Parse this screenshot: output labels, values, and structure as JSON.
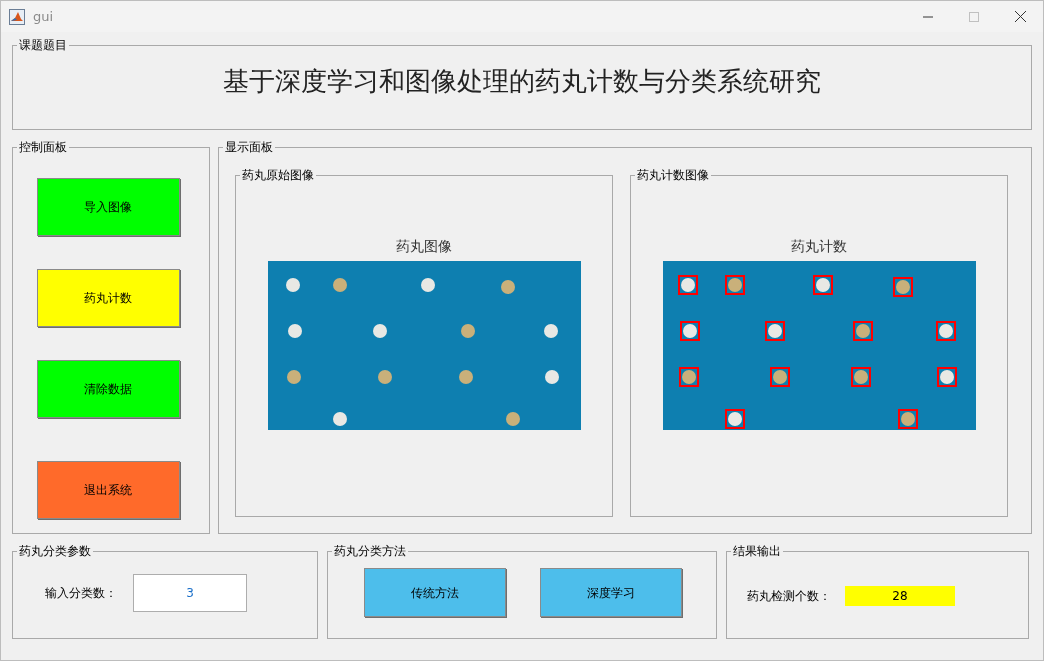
{
  "window": {
    "title": "gui"
  },
  "title_panel": {
    "legend": "课题题目",
    "text": "基于深度学习和图像处理的药丸计数与分类系统研究"
  },
  "control_panel": {
    "legend": "控制面板",
    "buttons": [
      {
        "label": "导入图像",
        "color": "#00ff00"
      },
      {
        "label": "药丸计数",
        "color": "#ffff00"
      },
      {
        "label": "清除数据",
        "color": "#00ff00"
      },
      {
        "label": "退出系统",
        "color": "#ff6a2a"
      }
    ]
  },
  "display_panel": {
    "legend": "显示面板",
    "images": [
      {
        "legend": "药丸原始图像",
        "caption": "药丸图像",
        "kind": "original"
      },
      {
        "legend": "药丸计数图像",
        "caption": "药丸计数",
        "kind": "counted"
      }
    ]
  },
  "params_panel": {
    "legend": "药丸分类参数",
    "label": "输入分类数：",
    "value": "3"
  },
  "method_panel": {
    "legend": "药丸分类方法",
    "buttons": [
      {
        "label": "传统方法"
      },
      {
        "label": "深度学习"
      }
    ]
  },
  "result_panel": {
    "legend": "结果输出",
    "label": "药丸检测个数：",
    "value": "28"
  }
}
